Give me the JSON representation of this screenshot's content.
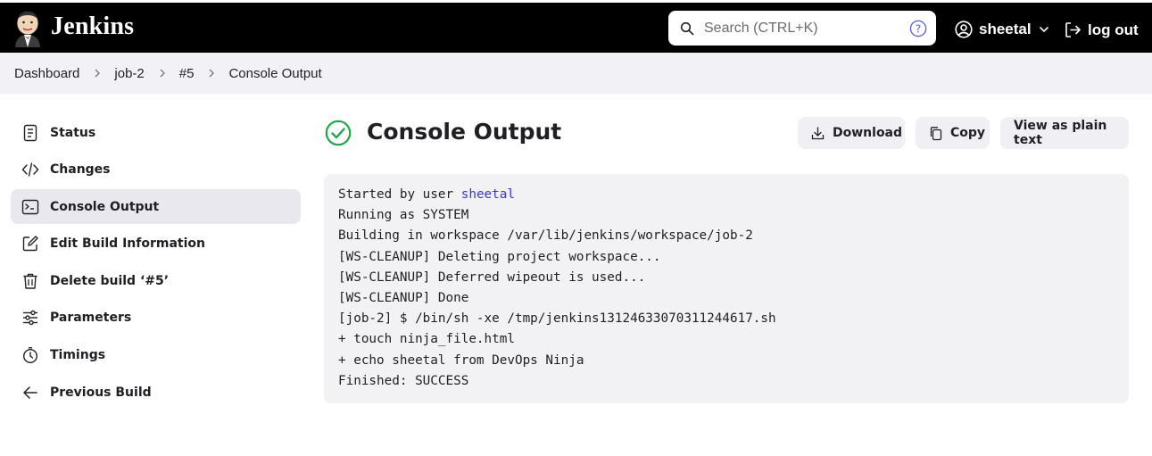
{
  "header": {
    "brand": "Jenkins",
    "search_placeholder": "Search (CTRL+K)",
    "user_name": "sheetal",
    "logout_label": "log out"
  },
  "breadcrumb": [
    "Dashboard",
    "job-2",
    "#5",
    "Console Output"
  ],
  "sidebar": {
    "items": [
      {
        "label": "Status",
        "icon": "document-icon"
      },
      {
        "label": "Changes",
        "icon": "code-icon"
      },
      {
        "label": "Console Output",
        "icon": "terminal-icon",
        "active": true
      },
      {
        "label": "Edit Build Information",
        "icon": "edit-icon"
      },
      {
        "label": "Delete build ‘#5’",
        "icon": "trash-icon"
      },
      {
        "label": "Parameters",
        "icon": "sliders-icon"
      },
      {
        "label": "Timings",
        "icon": "stopwatch-icon"
      },
      {
        "label": "Previous Build",
        "icon": "arrow-left-icon"
      }
    ]
  },
  "main": {
    "title": "Console Output",
    "status_color": "#1ea64b",
    "buttons": {
      "download": "Download",
      "copy": "Copy",
      "plain_text": "View as plain text"
    },
    "console": {
      "started_prefix": "Started by user ",
      "started_user": "sheetal",
      "lines": [
        "Running as SYSTEM",
        "Building in workspace /var/lib/jenkins/workspace/job-2",
        "[WS-CLEANUP] Deleting project workspace...",
        "[WS-CLEANUP] Deferred wipeout is used...",
        "[WS-CLEANUP] Done",
        "[job-2] $ /bin/sh -xe /tmp/jenkins13124633070311244617.sh",
        "+ touch ninja_file.html",
        "+ echo sheetal from DevOps Ninja",
        "Finished: SUCCESS"
      ]
    }
  },
  "colors": {
    "header_bg": "#000000",
    "breadcrumb_bg": "#f2f1f6",
    "link": "#3b37c9",
    "success": "#1ea64b"
  }
}
